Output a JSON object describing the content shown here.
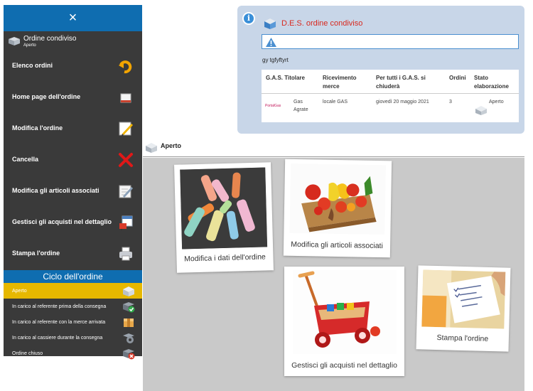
{
  "sidebar": {
    "close_label": "×",
    "header": {
      "title": "Ordine condiviso",
      "subtitle": "Aperto"
    },
    "items": [
      {
        "label": "Elenco ordini",
        "icon": "undo-arrow-icon"
      },
      {
        "label": "Home page dell'ordine",
        "icon": "home-page-icon"
      },
      {
        "label": "Modifica l'ordine",
        "icon": "edit-icon"
      },
      {
        "label": "Cancella",
        "icon": "delete-x-icon"
      },
      {
        "label": "Modifica gli articoli associati",
        "icon": "edit-articles-icon"
      },
      {
        "label": "Gestisci gli acquisti nel dettaglio",
        "icon": "calendar-cart-icon"
      },
      {
        "label": "Stampa l'ordine",
        "icon": "printer-icon"
      }
    ],
    "cycle_title": "Ciclo dell'ordine",
    "phases": [
      {
        "label": "Aperto",
        "active": true,
        "icon": "open-box-icon"
      },
      {
        "label": "In carico al referente prima della consegna",
        "active": false,
        "icon": "check-box-icon"
      },
      {
        "label": "In carico al referente con la merce arrivata",
        "active": false,
        "icon": "package-icon"
      },
      {
        "label": "In carico al cassiere durante la consegna",
        "active": false,
        "icon": "gear-box-icon"
      },
      {
        "label": "Ordine chiuso",
        "active": false,
        "icon": "closed-box-icon"
      }
    ]
  },
  "info": {
    "title": "D.E.S. ordine condiviso",
    "note": "gy tgfyftyrt",
    "table": {
      "headers": [
        "G.A.S. Titolare",
        "Ricevimento merce",
        "Per tutti i G.A.S. si chiuderà",
        "Ordini",
        "Stato elaborazione"
      ],
      "row": {
        "gas_name": "Gas Agrate",
        "logo_text": "PortalGas",
        "ricevimento": "locale GAS",
        "chiusura": "giovedì 20 maggio 2021",
        "ordini": "3",
        "stato": "Aperto"
      }
    }
  },
  "statebar": {
    "label": "Aperto"
  },
  "cards": [
    {
      "caption": "Modifica i dati dell'ordine"
    },
    {
      "caption": "Modifica gli articoli associati"
    },
    {
      "caption": "Gestisci gli acquisti nel dettaglio"
    },
    {
      "caption": "Stampa l'ordine"
    }
  ],
  "colors": {
    "sidebar_bg": "#3a3a3a",
    "accent_blue": "#0f6db0",
    "active_phase": "#e6b800",
    "panel_bg": "#c8d6e8",
    "title_red": "#d8281e",
    "grey_area": "#c9c9c9"
  }
}
